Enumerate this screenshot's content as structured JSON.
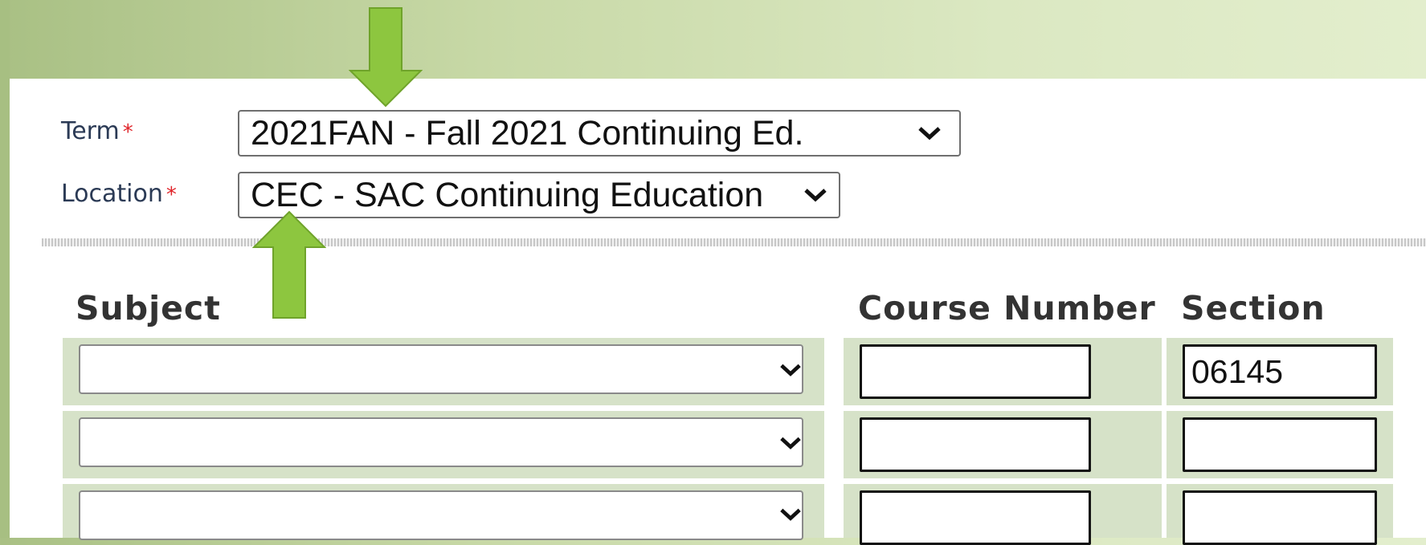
{
  "form": {
    "term": {
      "label": "Term",
      "required_marker": "*",
      "selected": "2021FAN - Fall 2021 Continuing Ed."
    },
    "location": {
      "label": "Location",
      "required_marker": "*",
      "selected": "CEC - SAC Continuing Education"
    }
  },
  "table": {
    "headers": {
      "subject": "Subject",
      "course_number": "Course Number",
      "section": "Section"
    },
    "rows": [
      {
        "subject": "",
        "course_number": "",
        "section": "06145"
      },
      {
        "subject": "",
        "course_number": "",
        "section": ""
      },
      {
        "subject": "",
        "course_number": "",
        "section": ""
      }
    ]
  },
  "annotations": {
    "arrow_color": "#8dc63f",
    "arrows": [
      "down-arrow-to-term",
      "up-arrow-to-location"
    ]
  },
  "colors": {
    "required_star": "#e0242a",
    "row_background": "#d6e2c8"
  }
}
